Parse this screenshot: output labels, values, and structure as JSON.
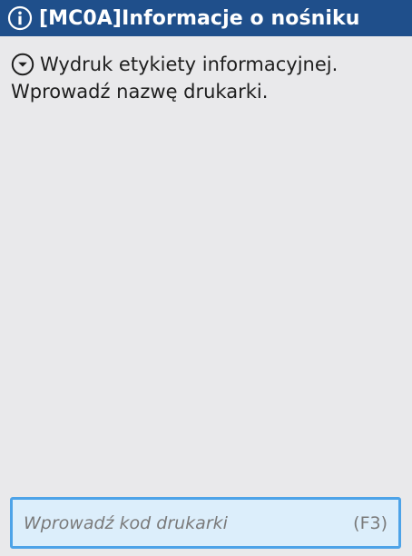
{
  "window": {
    "title": "[MC0A]Informacje o nośniku",
    "title_icon": "info-icon",
    "title_bar_color": "#1f4f8b"
  },
  "message": {
    "icon": "chevron-down-circle-icon",
    "line1": "Wydruk etykiety informacyjnej.",
    "line2": "Wprowadź nazwę drukarki."
  },
  "printer_input": {
    "value": "",
    "placeholder": "Wprowadź kod drukarki",
    "shortcut": "(F3)",
    "border_color": "#4da3e8",
    "background_color": "#dceefb"
  }
}
